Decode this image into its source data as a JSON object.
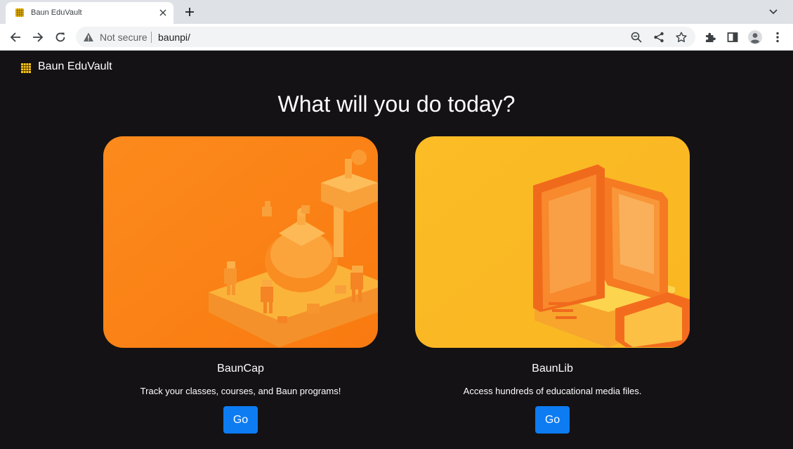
{
  "browser": {
    "tab_title": "Baun EduVault",
    "not_secure_label": "Not secure",
    "url": "baunpi/"
  },
  "site": {
    "brand": "Baun EduVault"
  },
  "main": {
    "headline": "What will you do today?",
    "cards": [
      {
        "title": "BaunCap",
        "description": "Track your classes, courses, and Baun programs!",
        "button_label": "Go"
      },
      {
        "title": "BaunLib",
        "description": "Access hundreds of educational media files.",
        "button_label": "Go"
      }
    ]
  },
  "colors": {
    "page_background": "#141214",
    "primary_button": "#0d7cf2",
    "card_orange": "#fb8c1a",
    "card_yellow": "#fbbf24"
  },
  "icons": {
    "favicon": "grid-logo-icon",
    "tab_close": "close-icon",
    "new_tab": "plus-icon",
    "back": "arrow-left-icon",
    "forward": "arrow-right-icon",
    "reload": "reload-icon",
    "security": "warning-triangle-icon",
    "zoom": "zoom-out-icon",
    "share": "share-icon",
    "bookmark": "star-icon",
    "extensions": "puzzle-icon",
    "side_panel": "side-panel-icon",
    "profile": "profile-icon",
    "menu": "kebab-menu-icon"
  }
}
